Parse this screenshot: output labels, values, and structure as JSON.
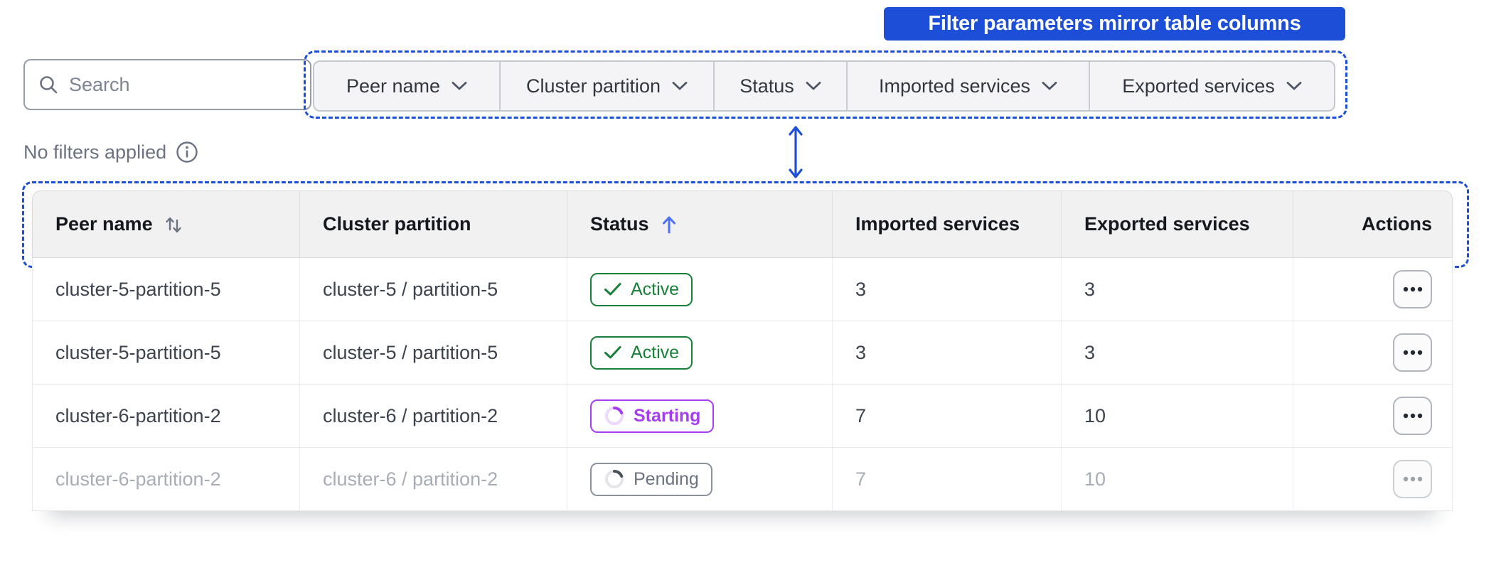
{
  "callout": {
    "label": "Filter parameters mirror table columns"
  },
  "search": {
    "placeholder": "Search"
  },
  "filter_bar": {
    "items": [
      {
        "label": "Peer name"
      },
      {
        "label": "Cluster partition"
      },
      {
        "label": "Status"
      },
      {
        "label": "Imported services"
      },
      {
        "label": "Exported services"
      }
    ]
  },
  "filter_status": {
    "label": "No filters applied"
  },
  "table": {
    "columns": {
      "peer_name": "Peer name",
      "cluster_partition": "Cluster partition",
      "status": "Status",
      "imported": "Imported services",
      "exported": "Exported services",
      "actions": "Actions"
    },
    "sort": {
      "peer_name": "sortable",
      "status": "ascending"
    },
    "rows": [
      {
        "peer_name": "cluster-5-partition-5",
        "cluster_partition": "cluster-5 / partition-5",
        "status": "Active",
        "imported": "3",
        "exported": "3"
      },
      {
        "peer_name": "cluster-5-partition-5",
        "cluster_partition": "cluster-5 / partition-5",
        "status": "Active",
        "imported": "3",
        "exported": "3"
      },
      {
        "peer_name": "cluster-6-partition-2",
        "cluster_partition": "cluster-6 / partition-2",
        "status": "Starting",
        "imported": "7",
        "exported": "10"
      },
      {
        "peer_name": "cluster-6-partition-2",
        "cluster_partition": "cluster-6 / partition-2",
        "status": "Pending",
        "imported": "7",
        "exported": "10"
      }
    ]
  },
  "colors": {
    "annotation_blue": "#1d4ed8",
    "sort_arrow_blue": "#4d6ef5",
    "status_active_green": "#188038",
    "status_starting_purple": "#a63df2",
    "status_pending_gray": "#6b7280"
  }
}
